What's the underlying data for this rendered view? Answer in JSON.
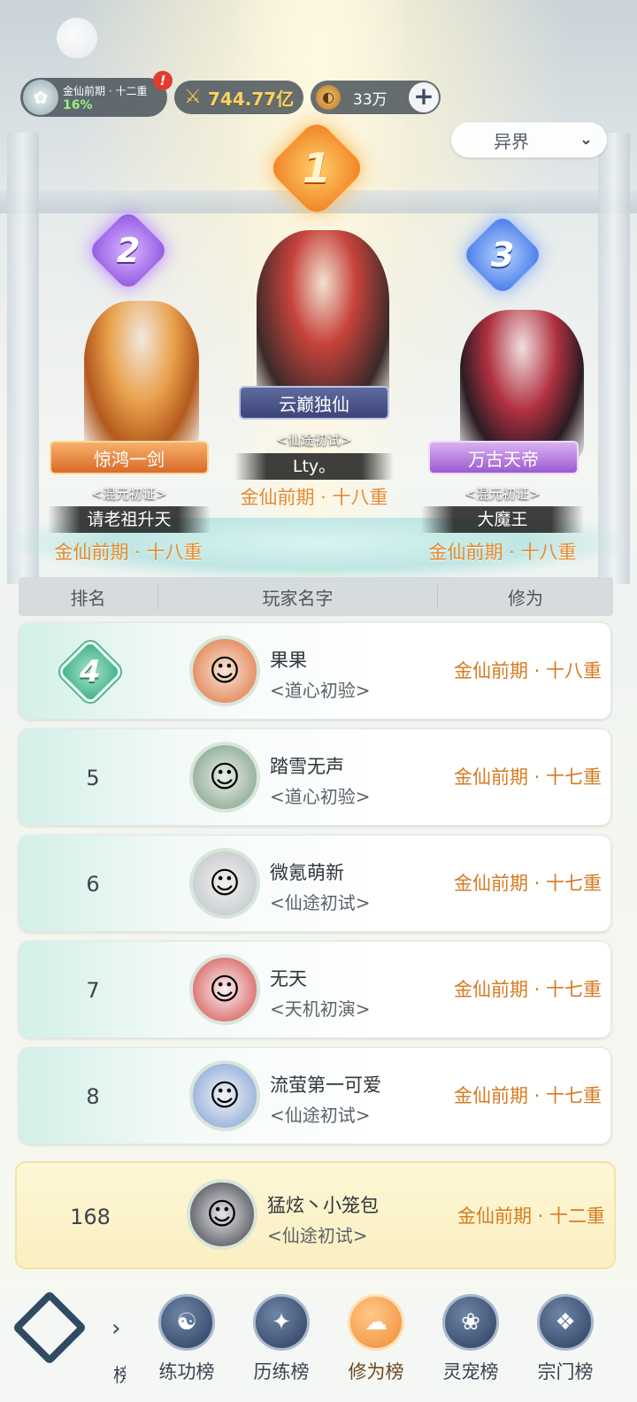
{
  "hud": {
    "level_name": "金仙前期 · 十二重",
    "level_progress": "16%",
    "alert": "!",
    "power": "744.77亿",
    "currency": "33万",
    "plus": "+"
  },
  "realm_selector": {
    "label": "异界"
  },
  "podium": [
    {
      "rank": "1",
      "plate": "云巅独仙",
      "title": "<仙途初试>",
      "name": "Lty。",
      "realm": "金仙前期 · 十八重"
    },
    {
      "rank": "2",
      "plate": "惊鸿一剑",
      "title": "<混元初证>",
      "name": "请老祖升天",
      "realm": "金仙前期 · 十八重"
    },
    {
      "rank": "3",
      "plate": "万古天帝",
      "title": "<混元初证>",
      "name": "大魔王",
      "realm": "金仙前期 · 十八重"
    }
  ],
  "table_header": {
    "rank": "排名",
    "name": "玩家名字",
    "level": "修为"
  },
  "rows": [
    {
      "rank": "4",
      "name": "果果",
      "title": "<道心初验>",
      "level": "金仙前期 · 十八重"
    },
    {
      "rank": "5",
      "name": "踏雪无声",
      "title": "<道心初验>",
      "level": "金仙前期 · 十七重"
    },
    {
      "rank": "6",
      "name": "微氪萌新",
      "title": "<仙途初试>",
      "level": "金仙前期 · 十七重"
    },
    {
      "rank": "7",
      "name": "无天",
      "title": "<天机初演>",
      "level": "金仙前期 · 十七重"
    },
    {
      "rank": "8",
      "name": "流萤第一可爱",
      "title": "<仙途初试>",
      "level": "金仙前期 · 十七重"
    }
  ],
  "my_row": {
    "rank": "168",
    "name": "猛炫丶小笼包",
    "title": "<仙途初试>",
    "level": "金仙前期 · 十二重"
  },
  "bottom_nav": {
    "cut_left": "榜",
    "items": [
      {
        "label": "练功榜",
        "icon": "yin-yang-icon"
      },
      {
        "label": "历练榜",
        "icon": "compass-icon"
      },
      {
        "label": "修为榜",
        "icon": "sage-hat-icon",
        "active": true
      },
      {
        "label": "灵宠榜",
        "icon": "pet-cat-icon"
      },
      {
        "label": "宗门榜",
        "icon": "scroll-icon"
      }
    ]
  },
  "colors": {
    "accent_orange": "#d57b22",
    "rank_green": "#3fae84",
    "my_row_bg": "#fbefc1"
  }
}
